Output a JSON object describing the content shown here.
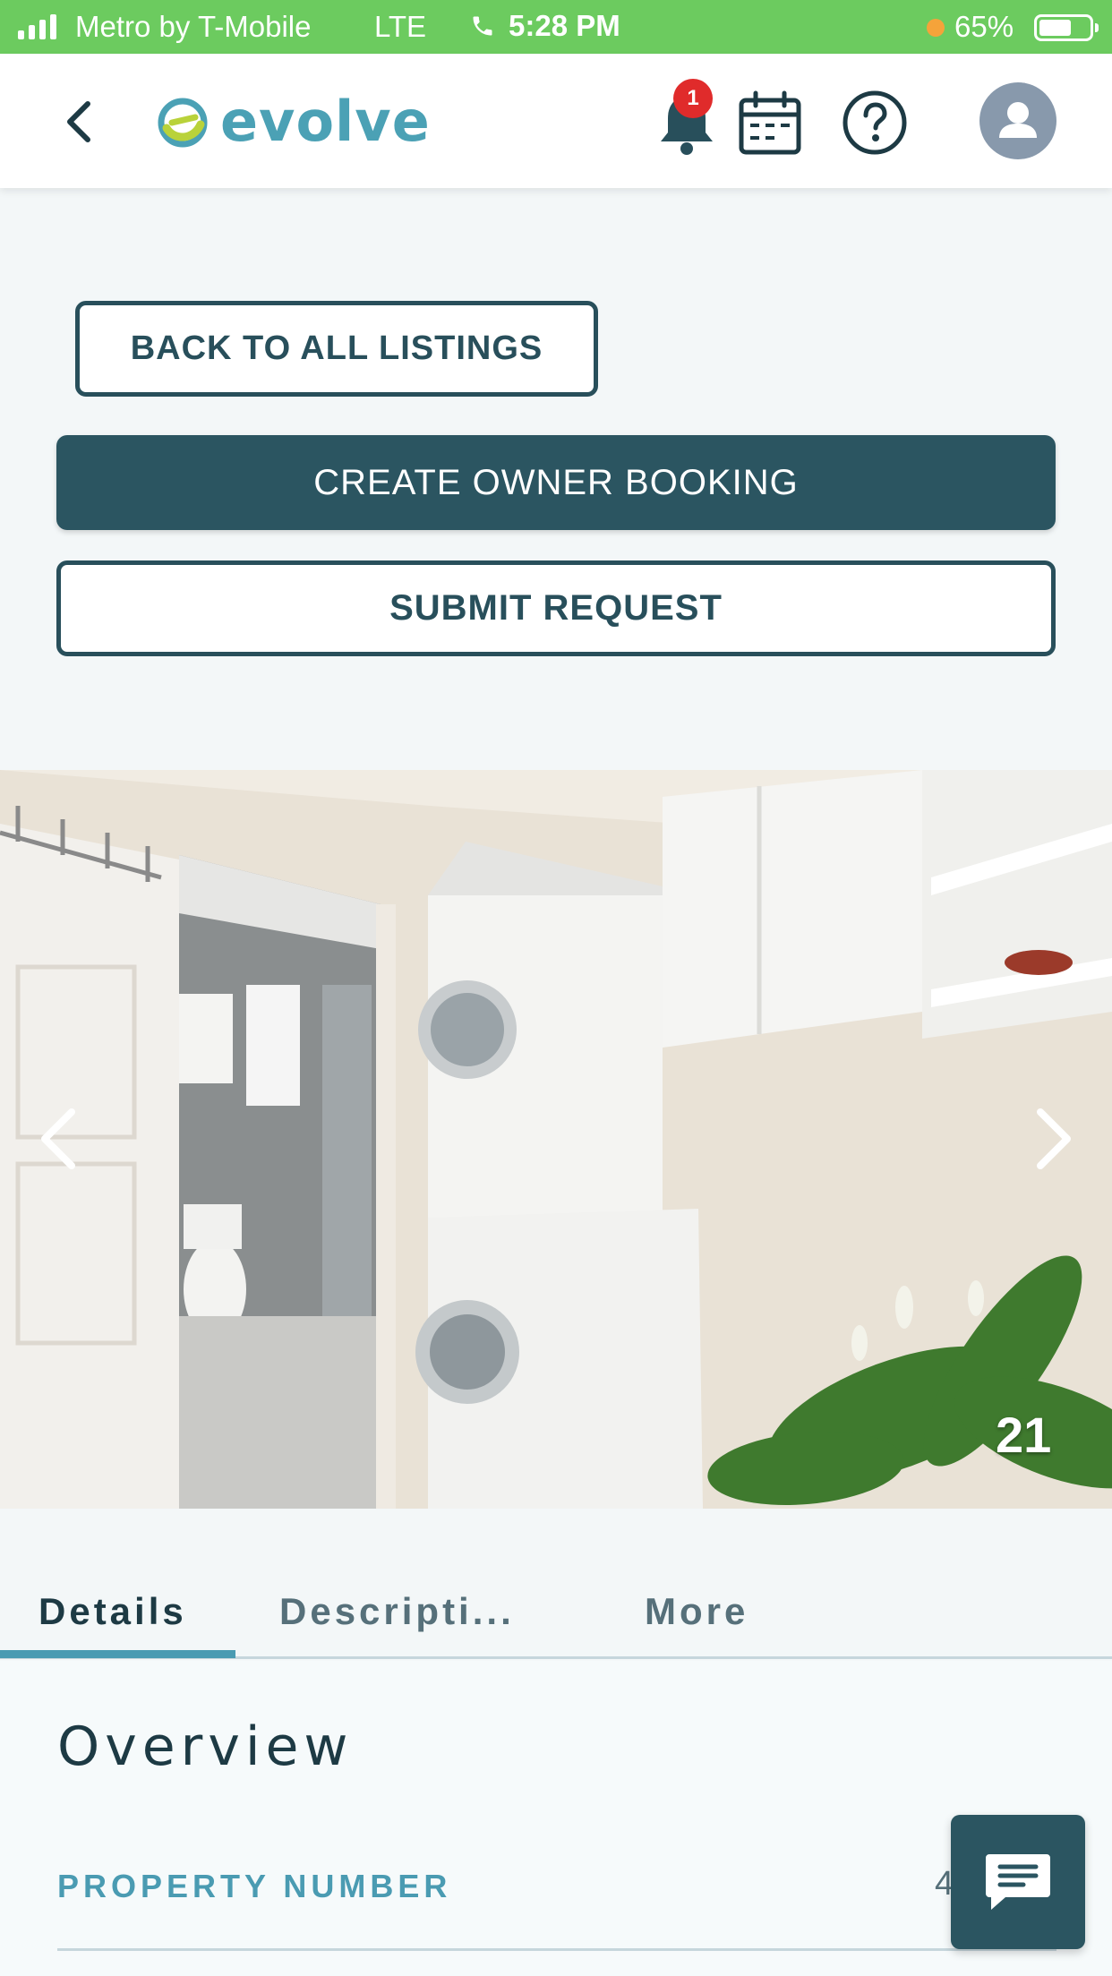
{
  "status_bar": {
    "carrier": "Metro by T-Mobile",
    "network": "LTE",
    "time": "5:28 PM",
    "battery": "65%",
    "battery_level": 0.65
  },
  "header": {
    "logo_text": "evolve",
    "notification_count": "1",
    "icons": [
      "chevron-left-icon",
      "evolve-logo",
      "bell-icon",
      "calendar-icon",
      "help-icon",
      "user-icon"
    ]
  },
  "actions": {
    "back_label": "BACK TO ALL LISTINGS",
    "create_booking_label": "CREATE OWNER BOOKING",
    "submit_request_label": "SUBMIT REQUEST"
  },
  "gallery": {
    "count": "21",
    "prev_icon": "chevron-left-icon",
    "next_icon": "chevron-right-icon"
  },
  "tabs": [
    {
      "label": "Details",
      "active": true
    },
    {
      "label": "Descripti...",
      "active": false
    },
    {
      "label": "More",
      "active": false
    }
  ],
  "overview": {
    "title": "Overview",
    "property_number_label": "PROPERTY NUMBER",
    "property_number_value": "4"
  },
  "colors": {
    "status_bar": "#6ccb5f",
    "primary": "#2b5561",
    "accent": "#4a9bb2",
    "badge": "#e02b2b"
  }
}
